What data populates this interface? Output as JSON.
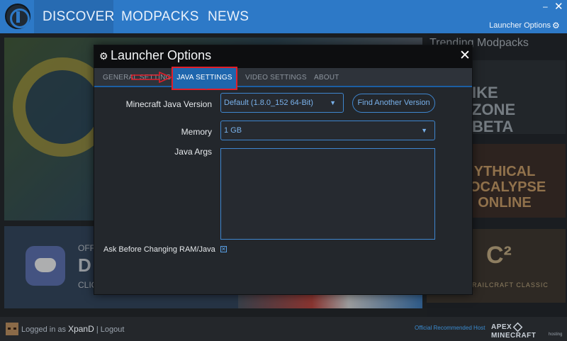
{
  "nav": {
    "tabs": [
      "DISCOVER",
      "MODPACKS",
      "NEWS"
    ],
    "active_tab": "DISCOVER",
    "launcher_options_label": "Launcher Options",
    "minimize_glyph": "–",
    "close_glyph": "✕"
  },
  "background": {
    "trending_title": "Trending Modpacks",
    "trending_tiles": [
      {
        "title": "IKE ZONE BETA"
      },
      {
        "title": "YTHICAL OCALYPSE ONLINE"
      },
      {
        "title": "C²",
        "subtitle": "RAILCRAFT CLASSIC"
      }
    ],
    "discord_card": {
      "line1": "OFFI",
      "line2": "D",
      "line3": "CLIC"
    }
  },
  "dialog": {
    "title": "Launcher Options",
    "close_glyph": "✕",
    "tabs": [
      "GENERAL SETTINGS",
      "JAVA SETTINGS",
      "VIDEO SETTINGS",
      "ABOUT"
    ],
    "active_tab": "JAVA SETTINGS",
    "java_settings": {
      "java_version_label": "Minecraft Java Version",
      "java_version_value": "Default (1.8.0_152 64-Bit)",
      "find_version_button": "Find Another Version",
      "memory_label": "Memory",
      "memory_value": "1 GB",
      "java_args_label": "Java Args",
      "java_args_value": "",
      "ask_ram_label": "Ask Before Changing RAM/Java",
      "ask_ram_checked": true
    }
  },
  "footer": {
    "logged_in_prefix": "Logged in as",
    "username": "XpanD",
    "separator": "|",
    "logout_label": "Logout",
    "recommended_host_label": "Official Recommended Host",
    "host_brand_left": "APEX",
    "host_brand_right": "MINECRAFT",
    "host_brand_sub": "hosting"
  },
  "colors": {
    "accent_blue": "#2d79c7",
    "tab_active": "#1e66ad",
    "annotation_red": "#e01e2a"
  },
  "icons": {
    "gear": "gear-icon",
    "caret": "caret-down-icon",
    "checkbox": "checkbox-checked-icon"
  }
}
